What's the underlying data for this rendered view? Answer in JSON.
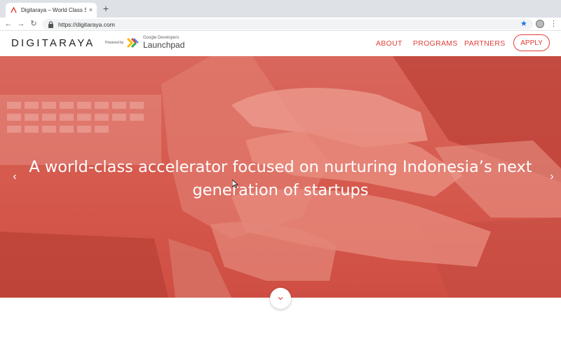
{
  "browser": {
    "tab_title": "Digitaraya – World Class Startu",
    "tab_close": "×",
    "new_tab": "+",
    "url": "https://digitaraya.com"
  },
  "header": {
    "logo_text": "DIGITARAYA",
    "powered_by": "Powered by",
    "partner_line1": "Google Developers",
    "partner_line2": "Launchpad",
    "nav": [
      "ABOUT",
      "PROGRAMS",
      "PARTNERS"
    ],
    "apply_label": "APPLY"
  },
  "hero": {
    "headline": "A world-class accelerator focused on nurturing Indonesia’s next generation of startups",
    "prev_icon": "chevron-left-icon",
    "next_icon": "chevron-right-icon",
    "scroll_icon": "chevron-down-icon"
  },
  "colors": {
    "accent": "#e0413a",
    "overlay": "#d65a4e"
  }
}
